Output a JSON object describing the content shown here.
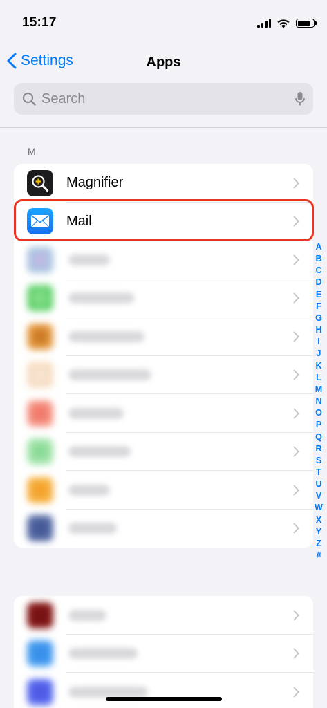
{
  "status_bar": {
    "time": "15:17",
    "battery_level": 0.8
  },
  "nav": {
    "back_label": "Settings",
    "title": "Apps"
  },
  "search": {
    "placeholder": "Search"
  },
  "section": {
    "header": "M"
  },
  "apps": [
    {
      "name": "Magnifier",
      "icon": "magnifier-icon"
    },
    {
      "name": "Mail",
      "icon": "mail-icon"
    }
  ],
  "blurred_rows": [
    {
      "color": "#a8c8e0",
      "accent": "#c7b3e6"
    },
    {
      "color": "#5fd16a",
      "accent": "#8de08f"
    },
    {
      "color": "#e8a14a",
      "accent": "#c26a14"
    },
    {
      "color": "#f7dcc0",
      "accent": "#f5e6d8"
    },
    {
      "color": "#f59a8a",
      "accent": "#f06b5b"
    },
    {
      "color": "#a8e6b0",
      "accent": "#7dd68a"
    },
    {
      "color": "#f7b64a",
      "accent": "#f29a1f"
    },
    {
      "color": "#5a6fa8",
      "accent": "#3b4f8f"
    }
  ],
  "blurred_rows_2": [
    {
      "color": "#8b1a1a",
      "accent": "#6b0f0f"
    },
    {
      "color": "#4a9ff0",
      "accent": "#2f88e8"
    },
    {
      "color": "#5a6ff0",
      "accent": "#4a4fe0"
    }
  ],
  "index_letters": [
    "A",
    "B",
    "C",
    "D",
    "E",
    "F",
    "G",
    "H",
    "I",
    "J",
    "K",
    "L",
    "M",
    "N",
    "O",
    "P",
    "Q",
    "R",
    "S",
    "T",
    "U",
    "V",
    "W",
    "X",
    "Y",
    "Z",
    "#"
  ],
  "colors": {
    "accent": "#007aff",
    "highlight": "#ea3323"
  }
}
